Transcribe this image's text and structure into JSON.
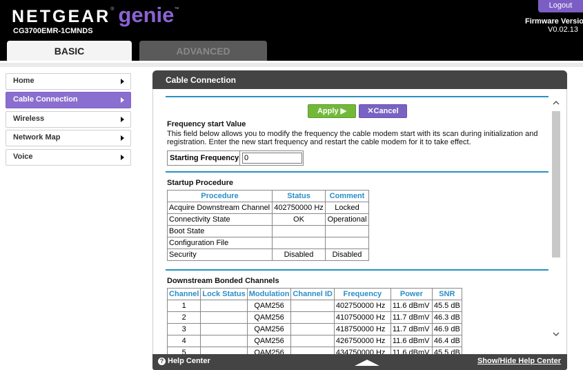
{
  "header": {
    "brand_main": "NETGEAR",
    "brand_reg": "®",
    "brand_genie": "genie",
    "brand_tm": "™",
    "model": "CG3700EMR-1CMNDS",
    "logout_label": "Logout",
    "firmware_label": "Firmware Version",
    "firmware_value": "V0.02.13"
  },
  "tabs": [
    {
      "label": "BASIC",
      "active": true
    },
    {
      "label": "ADVANCED",
      "active": false
    }
  ],
  "sidebar": {
    "items": [
      {
        "label": "Home",
        "active": false
      },
      {
        "label": "Cable Connection",
        "active": true
      },
      {
        "label": "Wireless",
        "active": false
      },
      {
        "label": "Network Map",
        "active": false
      },
      {
        "label": "Voice",
        "active": false
      }
    ]
  },
  "panel": {
    "title": "Cable Connection",
    "apply_label": "Apply ▶",
    "cancel_label": "✕Cancel",
    "freq_title": "Frequency start Value",
    "freq_desc": "This field below allows you to modify the frequency the cable modem start with its scan during initialization and registration. Enter the new start frequency and restart the cable modem for it to take effect.",
    "starting_freq_label": "Starting Frequency",
    "starting_freq_value": "0",
    "startup_title": "Startup Procedure",
    "startup_headers": [
      "Procedure",
      "Status",
      "Comment"
    ],
    "startup_rows": [
      [
        "Acquire Downstream Channel",
        "402750000 Hz",
        "Locked"
      ],
      [
        "Connectivity State",
        "OK",
        "Operational"
      ],
      [
        "Boot State",
        "",
        ""
      ],
      [
        "Configuration File",
        "",
        ""
      ],
      [
        "Security",
        "Disabled",
        "Disabled"
      ]
    ],
    "downstream_title": "Downstream Bonded Channels",
    "downstream_headers": [
      "Channel",
      "Lock Status",
      "Modulation",
      "Channel ID",
      "Frequency",
      "Power",
      "SNR"
    ],
    "downstream_rows": [
      [
        "1",
        "",
        "QAM256",
        "",
        "402750000 Hz",
        "11.6 dBmV",
        "45.5 dB"
      ],
      [
        "2",
        "",
        "QAM256",
        "",
        "410750000 Hz",
        "11.7 dBmV",
        "46.3 dB"
      ],
      [
        "3",
        "",
        "QAM256",
        "",
        "418750000 Hz",
        "11.7 dBmV",
        "46.9 dB"
      ],
      [
        "4",
        "",
        "QAM256",
        "",
        "426750000 Hz",
        "11.6 dBmV",
        "46.4 dB"
      ],
      [
        "5",
        "",
        "QAM256",
        "",
        "434750000 Hz",
        "11.6 dBmV",
        "45.5 dB"
      ]
    ]
  },
  "footer": {
    "help_label": "Help Center",
    "show_hide_label": "Show/Hide Help Center"
  },
  "colors": {
    "accent_purple": "#8a6fd0",
    "apply_green": "#72b93a",
    "header_blue": "#2b8ec7"
  }
}
